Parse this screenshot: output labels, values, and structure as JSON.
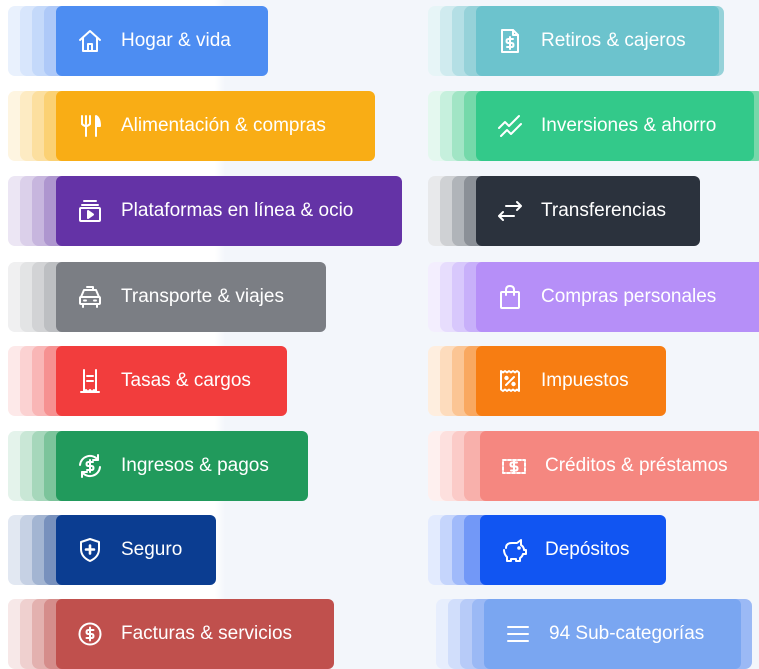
{
  "categories": {
    "left": [
      {
        "label": "Hogar & vida",
        "color": "#4d8df2",
        "icon": "house-icon"
      },
      {
        "label": "Alimentación & compras",
        "color": "#f9ad15",
        "icon": "fork-knife-icon"
      },
      {
        "label": "Plataformas en línea & ocio",
        "color": "#6433a6",
        "icon": "tv-play-icon"
      },
      {
        "label": "Transporte & viajes",
        "color": "#7b7e84",
        "icon": "taxi-icon"
      },
      {
        "label": "Tasas & cargos",
        "color": "#f23d3d",
        "icon": "receipt-icon"
      },
      {
        "label": "Ingresos & pagos",
        "color": "#219a5c",
        "icon": "money-cycle-icon"
      },
      {
        "label": "Seguro",
        "color": "#0b3d91",
        "icon": "shield-plus-icon"
      },
      {
        "label": "Facturas & servicios",
        "color": "#c0504d",
        "icon": "dollar-circle-icon"
      }
    ],
    "right": [
      {
        "label": "Retiros & cajeros",
        "color": "#6cc3cd",
        "icon": "dollar-document-icon"
      },
      {
        "label": "Inversiones & ahorro",
        "color": "#33c98a",
        "icon": "trend-lines-icon"
      },
      {
        "label": "Transferencias",
        "color": "#2b323d",
        "icon": "swap-arrows-icon"
      },
      {
        "label": "Compras personales",
        "color": "#b68ff8",
        "icon": "shopping-bag-icon"
      },
      {
        "label": "Impuestos",
        "color": "#f77d12",
        "icon": "percent-stamp-icon"
      },
      {
        "label": "Créditos & préstamos",
        "color": "#f58780",
        "icon": "banknote-icon"
      },
      {
        "label": "Depósitos",
        "color": "#1155f2",
        "icon": "piggy-bank-icon"
      },
      {
        "label": "94 Sub-categorías",
        "color": "#7aa6f1",
        "icon": "menu-lines-icon"
      }
    ]
  }
}
